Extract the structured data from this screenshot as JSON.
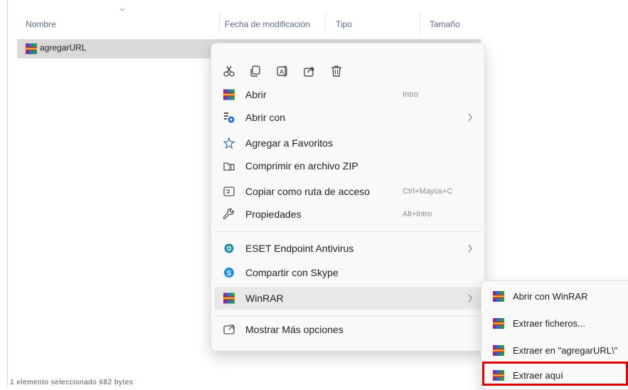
{
  "columns": {
    "name": "Nombre",
    "modified": "Fecha de modificación",
    "type": "Tipo",
    "size": "Tamaño"
  },
  "file": {
    "name": "agregarURL",
    "icon": "winrar-archive-icon"
  },
  "quick_actions": [
    {
      "name": "cut-icon"
    },
    {
      "name": "copy-icon"
    },
    {
      "name": "rename-icon"
    },
    {
      "name": "share-icon"
    },
    {
      "name": "delete-icon"
    }
  ],
  "menu": {
    "items": [
      {
        "label": "Abrir",
        "shortcut": "Intro",
        "icon": "winrar-icon"
      },
      {
        "label": "Abrir con",
        "shortcut": "",
        "icon": "open-with-icon",
        "submenu": true
      },
      {
        "label": "Agregar a Favoritos",
        "shortcut": "",
        "icon": "star-icon"
      },
      {
        "label": "Comprimir en archivo ZIP",
        "shortcut": "",
        "icon": "zip-icon"
      },
      {
        "label": "Copiar como ruta de acceso",
        "shortcut": "Ctrl+Mayús+C",
        "icon": "copy-path-icon"
      },
      {
        "label": "Propiedades",
        "shortcut": "Alt+Intro",
        "icon": "wrench-icon"
      },
      {
        "label": "ESET Endpoint Antivirus",
        "shortcut": "",
        "icon": "eset-icon",
        "submenu": true
      },
      {
        "label": "Compartir con Skype",
        "shortcut": "",
        "icon": "skype-icon"
      },
      {
        "label": "WinRAR",
        "shortcut": "",
        "icon": "winrar-icon",
        "submenu": true
      },
      {
        "label": "Mostrar Más opciones",
        "shortcut": "",
        "icon": "more-options-icon"
      }
    ]
  },
  "submenu": {
    "items": [
      {
        "label": "Abrir con WinRAR"
      },
      {
        "label": "Extraer ficheros..."
      },
      {
        "label": "Extraer en \"agregarURL\\\""
      },
      {
        "label": "Extraer aquí"
      }
    ]
  },
  "status_text": "1 elemento seleccionado 682 bytes",
  "colors": {
    "highlight": "#e00000",
    "selection": "#d9d9d9",
    "menu_bg": "#f9f9f9"
  }
}
